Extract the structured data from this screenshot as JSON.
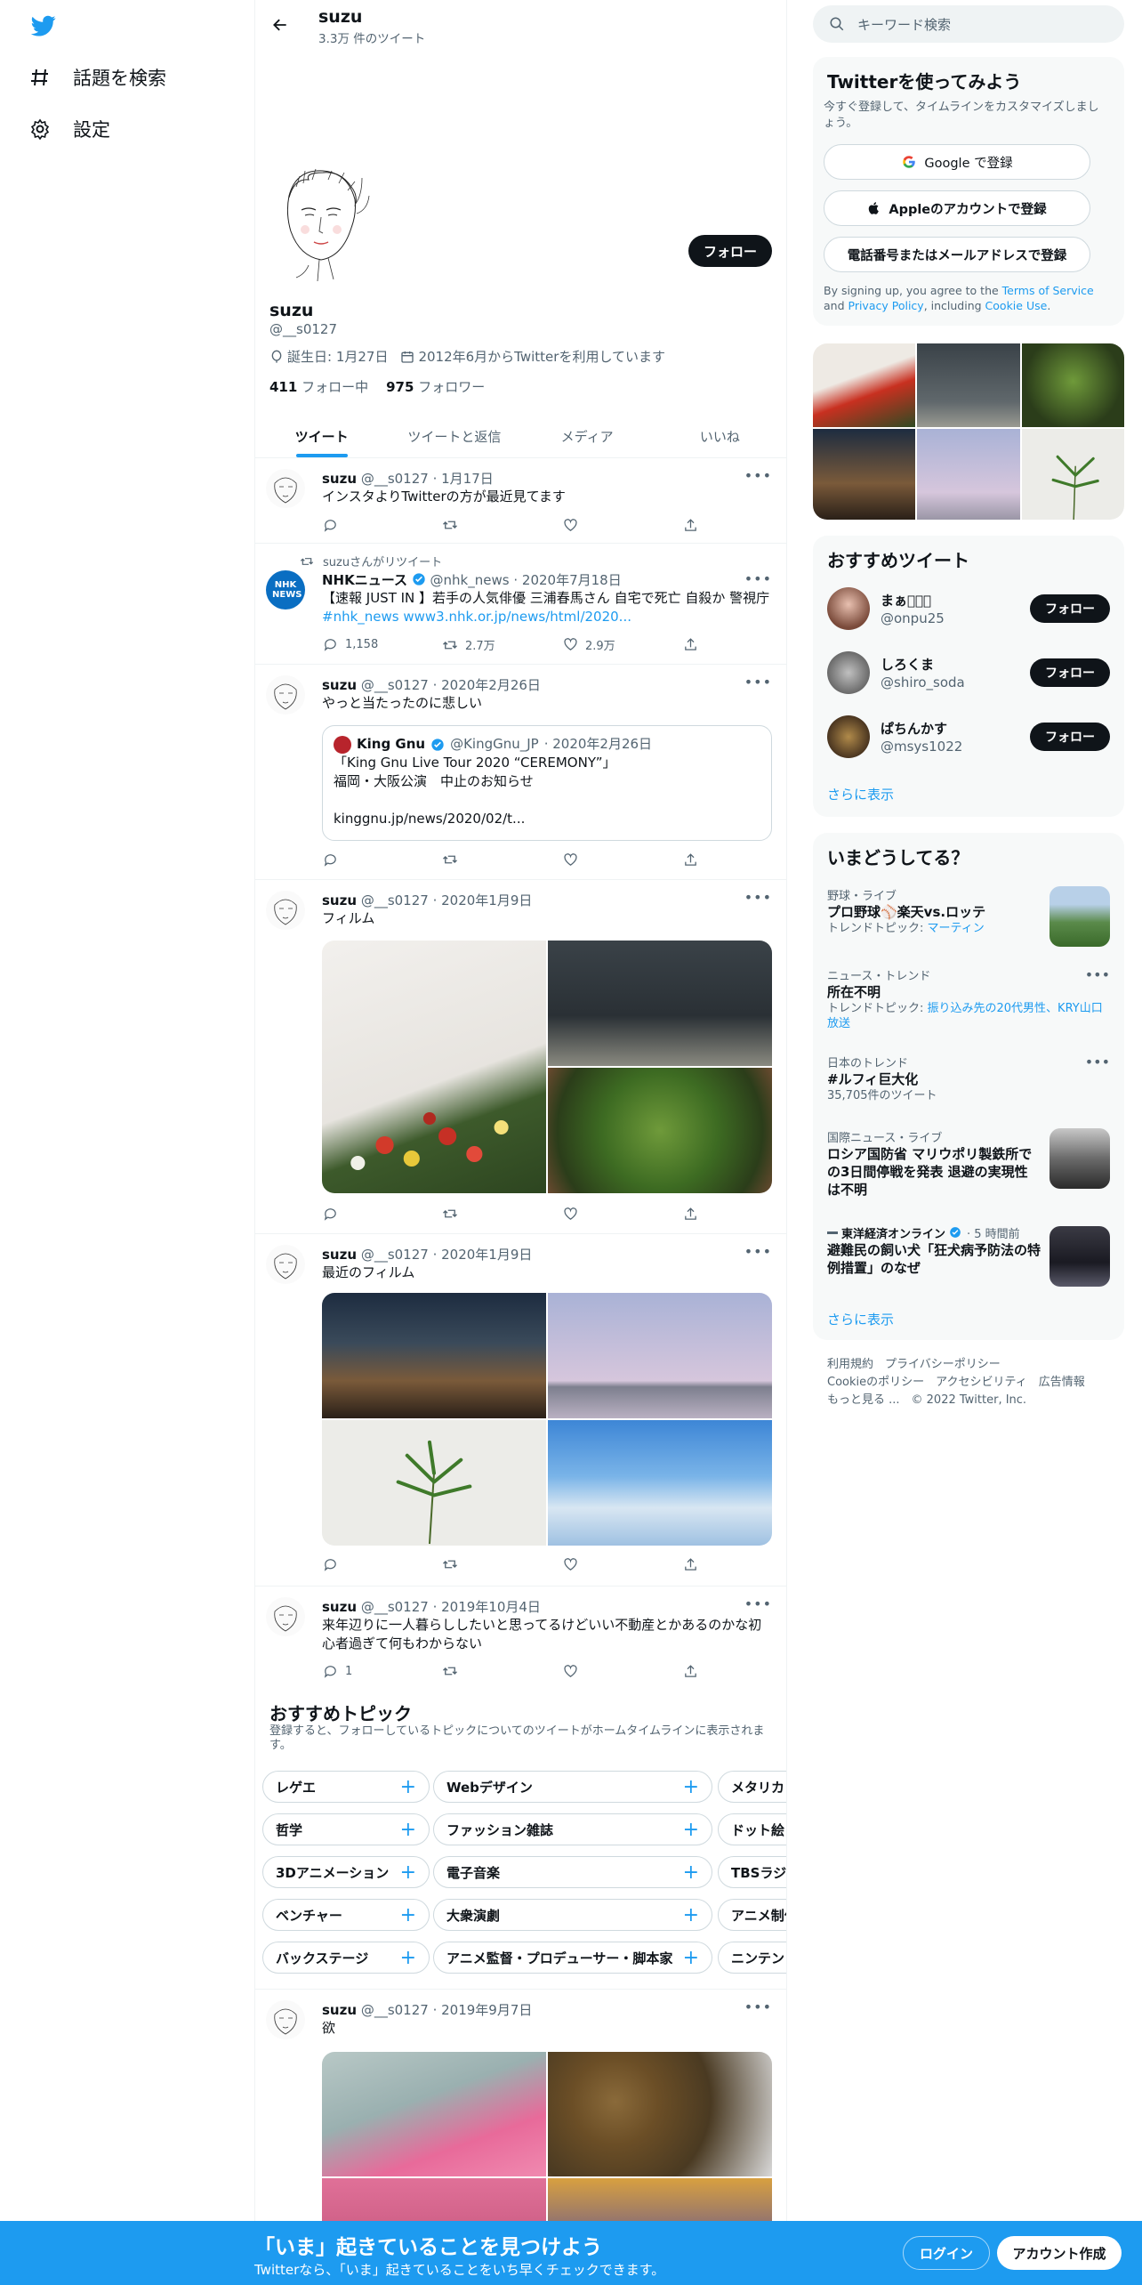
{
  "nav": {
    "explore_label": "話題を検索",
    "settings_label": "設定"
  },
  "header": {
    "name": "suzu",
    "tweet_count": "3.3万 件のツイート"
  },
  "profile": {
    "name": "suzu",
    "handle": "@__s0127",
    "birthday": "誕生日: 1月27日",
    "joined": "2012年6月からTwitterを利用しています",
    "following_count": "411",
    "following_label": "フォロー中",
    "followers_count": "975",
    "followers_label": "フォロワー",
    "follow_button": "フォロー"
  },
  "tabs": [
    "ツイート",
    "ツイートと返信",
    "メディア",
    "いいね"
  ],
  "tweets": [
    {
      "name": "suzu",
      "handle": "@__s0127",
      "date": "· 1月17日",
      "text": "インスタよりTwitterの方が最近見てます"
    },
    {
      "retweet_label": "suzuさんがリツイート",
      "name": "NHKニュース",
      "handle": "@nhk_news",
      "date": "· 2020年7月18日",
      "text": "【速報 JUST IN 】若手の人気俳優 三浦春馬さん 自宅で死亡 自殺か 警視庁 ",
      "link_text": "#nhk_news www3.nhk.or.jp/news/html/2020...",
      "avatar_text": "NHK NEWS",
      "reply_count": "1,158",
      "retweet_count": "2.7万",
      "like_count": "2.9万"
    },
    {
      "name": "suzu",
      "handle": "@__s0127",
      "date": "· 2020年2月26日",
      "text": "やっと当たったのに悲しい",
      "quote": {
        "name": "King Gnu",
        "handle": "@KingGnu_JP",
        "date": "· 2020年2月26日",
        "line1": "「King Gnu Live Tour 2020 “CEREMONY”」",
        "line2": "福岡・大阪公演　中止のお知らせ",
        "line3": "kinggnu.jp/news/2020/02/t..."
      }
    },
    {
      "name": "suzu",
      "handle": "@__s0127",
      "date": "· 2020年1月9日",
      "text": "フィルム"
    },
    {
      "name": "suzu",
      "handle": "@__s0127",
      "date": "· 2020年1月9日",
      "text": "最近のフィルム"
    },
    {
      "name": "suzu",
      "handle": "@__s0127",
      "date": "· 2019年10月4日",
      "text": "来年辺りに一人暮らししたいと思ってるけどいい不動産とかあるのかな初心者過ぎて何もわからない",
      "reply_count": "1"
    },
    {
      "name": "suzu",
      "handle": "@__s0127",
      "date": "· 2019年9月7日",
      "text": "欲"
    }
  ],
  "topics": {
    "title": "おすすめトピック",
    "subtitle": "登録すると、フォローしているトピックについてのツイートがホームタイムラインに表示されます。",
    "col1": [
      "レゲエ",
      "哲学",
      "3Dアニメーション",
      "ベンチャー",
      "バックステージ"
    ],
    "col2": [
      "Webデザイン",
      "ファッション雑誌",
      "電子音楽",
      "大衆演劇",
      "アニメ監督・プロデューサー・脚本家"
    ],
    "col3": [
      "メタリカ",
      "ドット絵",
      "TBSラジオ",
      "アニメ制作",
      "ニンテンドー"
    ]
  },
  "search": {
    "placeholder": "キーワード検索"
  },
  "signup_card": {
    "title": "Twitterを使ってみよう",
    "subtitle": "今すぐ登録して、タイムラインをカスタマイズしましょう。",
    "google": "Google で登録",
    "apple": "Appleのアカウントで登録",
    "phone": "電話番号またはメールアドレスで登録",
    "terms_prefix": "By signing up, you agree to the ",
    "terms_link": "Terms of Service",
    "terms_mid": " and ",
    "privacy_link": "Privacy Policy",
    "terms_mid2": ", including ",
    "cookie_link": "Cookie Use",
    "terms_end": "."
  },
  "recommended": {
    "title": "おすすめツイート",
    "users": [
      {
        "name": "まぁさ🏻🏻",
        "handle": "@onpu25"
      },
      {
        "name": "しろくま",
        "handle": "@shiro_soda"
      },
      {
        "name": "ぱちんかす",
        "handle": "@msys1022"
      }
    ],
    "follow": "フォロー",
    "show_more": "さらに表示"
  },
  "trends": {
    "title": "いまどうしてる？",
    "items": [
      {
        "context": "野球・ライブ",
        "title": "プロ野球⚾楽天vs.ロッテ",
        "sub_prefix": "トレンドトピック: ",
        "sub_link": "マーティン"
      },
      {
        "context": "ニュース・トレンド",
        "title": "所在不明",
        "sub_prefix": "トレンドトピック: ",
        "sub_link": "振り込み先の20代男性、KRY山口放送"
      },
      {
        "context": "日本のトレンド",
        "title": "#ルフィ巨大化",
        "sub_prefix": "35,705件のツイート",
        "sub_link": ""
      },
      {
        "context": "国際ニュース・ライブ",
        "title": "ロシア国防省 マリウポリ製鉄所での3日間停戦を発表 退避の実現性は不明",
        "sub_prefix": "",
        "sub_link": ""
      },
      {
        "context": "東洋経済オンライン",
        "context_time": "· 5 時間前",
        "title": "避難民の飼い犬「狂犬病予防法の特例措置」のなぜ",
        "sub_prefix": "",
        "sub_link": ""
      }
    ],
    "show_more": "さらに表示"
  },
  "footer": {
    "line1": "利用規約　プライバシーポリシー",
    "line2": "Cookieのポリシー　アクセシビリティ　広告情報",
    "line3": "もっと見る ...　© 2022 Twitter, Inc."
  },
  "bottom_bar": {
    "title": "「いま」起きていることを見つけよう",
    "subtitle": "Twitterなら、「いま」起きていることをいち早くチェックできます。",
    "login": "ログイン",
    "signup": "アカウント作成"
  },
  "colors": {
    "accent": "#1d9bf0",
    "text": "#0f1419",
    "secondary": "#536471",
    "banner": "#1d9bf0"
  }
}
